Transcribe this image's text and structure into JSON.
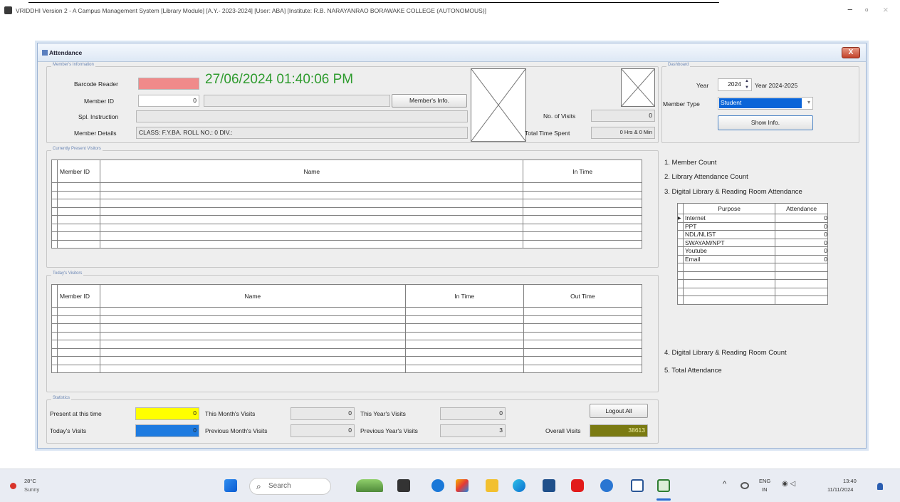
{
  "app_title": "VRIDDHI Version 2 - A Campus Management System [Library Module] [A.Y.- 2023-2024] [User: ABA] [Institute: R.B. NARAYANRAO BORAWAKE COLLEGE (AUTONOMOUS)]",
  "window_controls": {
    "minimize": "−",
    "maximize": "▫",
    "close": "×"
  },
  "form": {
    "title": "Attendance",
    "close_label": "X",
    "members_info": {
      "group_title": "Member's Information",
      "barcode_label": "Barcode Reader",
      "datetime": "27/06/2024 01:40:06 PM",
      "member_id_label": "Member ID",
      "member_id_value": "0",
      "member_info_button": "Member's Info.",
      "spl_instruction_label": "Spl. Instruction",
      "member_details_label": "Member Details",
      "member_details_value": "CLASS: F.Y.BA.    ROLL NO.: 0    DIV.:",
      "no_of_visits_label": "No. of Visits",
      "no_of_visits_value": "0",
      "total_time_label": "Total Time Spent",
      "total_time_value": "0 Hrs & 0 Min"
    },
    "dashboard": {
      "group_title": "Dashboard",
      "year_label": "Year",
      "year_value": "2024",
      "year_range": "Year 2024-2025",
      "member_type_label": "Member Type",
      "member_type_value": "Student",
      "show_info_button": "Show Info.",
      "links": [
        "1. Member Count",
        "2. Library Attendance Count",
        "3. Digital Library & Reading Room Attendance",
        "4. Digital Library & Reading Room Count",
        "5. Total Attendance"
      ],
      "purpose_table": {
        "headers": [
          "Purpose",
          "Attendance"
        ],
        "rows": [
          [
            "Internet",
            "0"
          ],
          [
            "PPT",
            "0"
          ],
          [
            "NDL/NLIST",
            "0"
          ],
          [
            "SWAYAM/NPT",
            "0"
          ],
          [
            "Youtube",
            "0"
          ],
          [
            "Email",
            "0"
          ]
        ]
      }
    },
    "present_visitors": {
      "group_title": "Currently Present Visitors",
      "headers": [
        "Member ID",
        "Name",
        "In Time"
      ]
    },
    "todays_visitors": {
      "group_title": "Today's Visitors",
      "headers": [
        "Member ID",
        "Name",
        "In Time",
        "Out Time"
      ]
    },
    "status": {
      "group_title": "Statistics",
      "present_label": "Present at this time",
      "present_value": "0",
      "todays_visits_label": "Today's Visits",
      "todays_visits_value": "0",
      "this_month_label": "This Month's Visits",
      "this_month_value": "0",
      "prev_month_label": "Previous Month's Visits",
      "prev_month_value": "0",
      "this_year_label": "This Year's Visits",
      "this_year_value": "0",
      "prev_year_label": "Previous Year's Visits",
      "prev_year_value": "3",
      "logout_all_button": "Logout All",
      "overall_label": "Overall Visits",
      "overall_value": "38613"
    }
  },
  "taskbar": {
    "weather_temp": "28°C",
    "weather_desc": "Sunny",
    "search_placeholder": "Search",
    "lang_top": "ENG",
    "lang_bottom": "IN",
    "time": "13:40",
    "date": "11/11/2024"
  },
  "colors": {
    "barcode_field": "#f08a8a",
    "datetime_text": "#2e9b2e",
    "present_field": "#ffff00",
    "todays_field": "#1e7be0",
    "overall_field": "#7a7a12",
    "member_type_highlight": "#0a64d8"
  }
}
